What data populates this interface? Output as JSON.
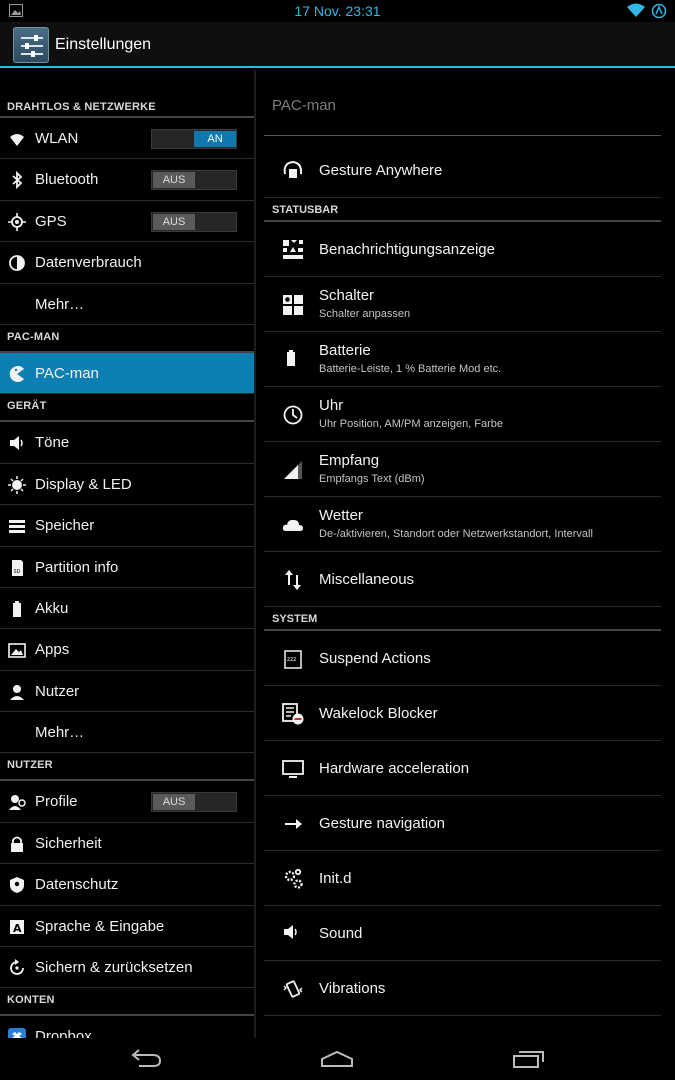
{
  "status_bar": {
    "time": "17 Nov. 23:31",
    "icons": [
      "gallery-icon",
      "wifi-icon",
      "battery-icon"
    ]
  },
  "action_bar": {
    "title": "Einstellungen",
    "icon": "settings-sliders-icon"
  },
  "colors": {
    "accent": "#33b5e5",
    "selected": "#0e7fb3"
  },
  "left": {
    "sections": [
      {
        "header": "DRAHTLOS & NETZWERKE",
        "items": [
          {
            "label": "WLAN",
            "icon": "wifi-icon",
            "toggle": "AN"
          },
          {
            "label": "Bluetooth",
            "icon": "bluetooth-icon",
            "toggle": "AUS"
          },
          {
            "label": "GPS",
            "icon": "gps-icon",
            "toggle": "AUS"
          },
          {
            "label": "Datenverbrauch",
            "icon": "data-usage-icon"
          },
          {
            "label": "Mehr…"
          }
        ]
      },
      {
        "header": "PAC-MAN",
        "items": [
          {
            "label": "PAC-man",
            "icon": "pacman-icon",
            "selected": true
          }
        ]
      },
      {
        "header": "GERÄT",
        "items": [
          {
            "label": "Töne",
            "icon": "volume-icon"
          },
          {
            "label": "Display & LED",
            "icon": "brightness-icon"
          },
          {
            "label": "Speicher",
            "icon": "storage-icon"
          },
          {
            "label": "Partition info",
            "icon": "sd-card-icon"
          },
          {
            "label": "Akku",
            "icon": "battery-icon"
          },
          {
            "label": "Apps",
            "icon": "apps-icon"
          },
          {
            "label": "Nutzer",
            "icon": "user-icon"
          },
          {
            "label": "Mehr…"
          }
        ]
      },
      {
        "header": "NUTZER",
        "items": [
          {
            "label": "Profile",
            "icon": "profile-icon",
            "toggle": "AUS"
          },
          {
            "label": "Sicherheit",
            "icon": "lock-icon"
          },
          {
            "label": "Datenschutz",
            "icon": "shield-icon"
          },
          {
            "label": "Sprache & Eingabe",
            "icon": "keyboard-icon"
          },
          {
            "label": "Sichern & zurücksetzen",
            "icon": "backup-icon"
          }
        ]
      },
      {
        "header": "KONTEN",
        "items": [
          {
            "label": "Dropbox",
            "icon": "dropbox-icon"
          }
        ]
      }
    ]
  },
  "right": {
    "header": "PAC-man",
    "blocks": [
      {
        "type": "item",
        "title": "Gesture Anywhere",
        "icon": "gesture-anywhere-icon"
      },
      {
        "type": "section",
        "title": "STATUSBAR"
      },
      {
        "type": "item",
        "title": "Benachrichtigungsanzeige",
        "icon": "notification-grid-icon"
      },
      {
        "type": "item",
        "title": "Schalter",
        "sub": "Schalter anpassen",
        "icon": "toggles-icon"
      },
      {
        "type": "item",
        "title": "Batterie",
        "sub": "Batterie-Leiste, 1 % Batterie Mod etc.",
        "icon": "battery-icon"
      },
      {
        "type": "item",
        "title": "Uhr",
        "sub": "Uhr Position, AM/PM anzeigen, Farbe",
        "icon": "clock-icon"
      },
      {
        "type": "item",
        "title": "Empfang",
        "sub": "Empfangs Text (dBm)",
        "icon": "signal-icon"
      },
      {
        "type": "item",
        "title": "Wetter",
        "sub": "De-/aktivieren, Standort oder Netzwerkstandort, Intervall",
        "icon": "cloud-icon"
      },
      {
        "type": "item",
        "title": "Miscellaneous",
        "icon": "swap-arrows-icon"
      },
      {
        "type": "section",
        "title": "SYSTEM"
      },
      {
        "type": "item",
        "title": "Suspend Actions",
        "icon": "suspend-icon"
      },
      {
        "type": "item",
        "title": "Wakelock Blocker",
        "icon": "wakelock-blocker-icon"
      },
      {
        "type": "item",
        "title": "Hardware acceleration",
        "icon": "monitor-icon"
      },
      {
        "type": "item",
        "title": "Gesture navigation",
        "icon": "arrow-right-icon"
      },
      {
        "type": "item",
        "title": "Init.d",
        "icon": "gears-icon"
      },
      {
        "type": "item",
        "title": "Sound",
        "icon": "volume-icon"
      },
      {
        "type": "item",
        "title": "Vibrations",
        "icon": "vibrate-icon"
      }
    ]
  },
  "nav_bar": {
    "buttons": [
      "back-icon",
      "home-icon",
      "recents-icon"
    ]
  }
}
